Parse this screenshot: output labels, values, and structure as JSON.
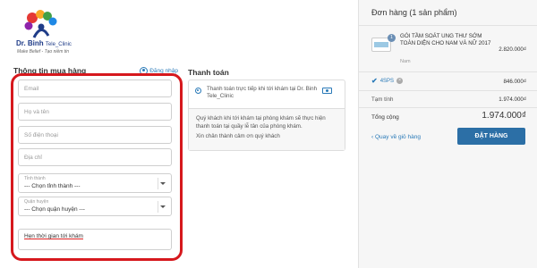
{
  "brand": {
    "name": "Dr. Binh",
    "suffix": "Tele_Clinic",
    "tagline": "Make Belief - Tạo niềm tin"
  },
  "form": {
    "title": "Thông tin mua hàng",
    "login_label": "Đăng nhập",
    "email_placeholder": "Email",
    "name_placeholder": "Họ và tên",
    "phone_placeholder": "Số điện thoại",
    "address_placeholder": "Địa chỉ",
    "province": {
      "label": "Tỉnh thành",
      "value": "--- Chọn tỉnh thành ---"
    },
    "district": {
      "label": "Quận huyện",
      "value": "--- Chọn quận huyện ---"
    },
    "note_value": "Hẹn thời gian tới khám"
  },
  "payment": {
    "title": "Thanh toán",
    "option_label": "Thanh toán trực tiếp khi tới khám tại Dr. Binh Tele_Clinic",
    "description_line1": "Quý khách khi tới khám tại phòng khám sẽ thực hiện thanh toán tại quầy lễ tân của phòng khám.",
    "description_line2": "Xin chân thành cảm ơn quý khách"
  },
  "order": {
    "title": "Đơn hàng (1 sản phẩm)",
    "item": {
      "qty": "1",
      "name": "GÓI TẦM SOÁT UNG THƯ SỚM TOÀN DIỆN CHO NAM VÀ NỮ 2017",
      "variant": "Nam",
      "price": "2.820.000₫"
    },
    "coupon_code": "4SPS",
    "coupon_value": "846.000₫",
    "subtotal_label": "Tạm tính",
    "subtotal_value": "1.974.000₫",
    "total_label": "Tổng cộng",
    "total_value": "1.974.000₫",
    "back_label": "Quay về giỏ hàng",
    "order_button": "ĐẶT HÀNG"
  },
  "colors": {
    "accent": "#2c6fa6",
    "highlight": "#d6181d"
  }
}
